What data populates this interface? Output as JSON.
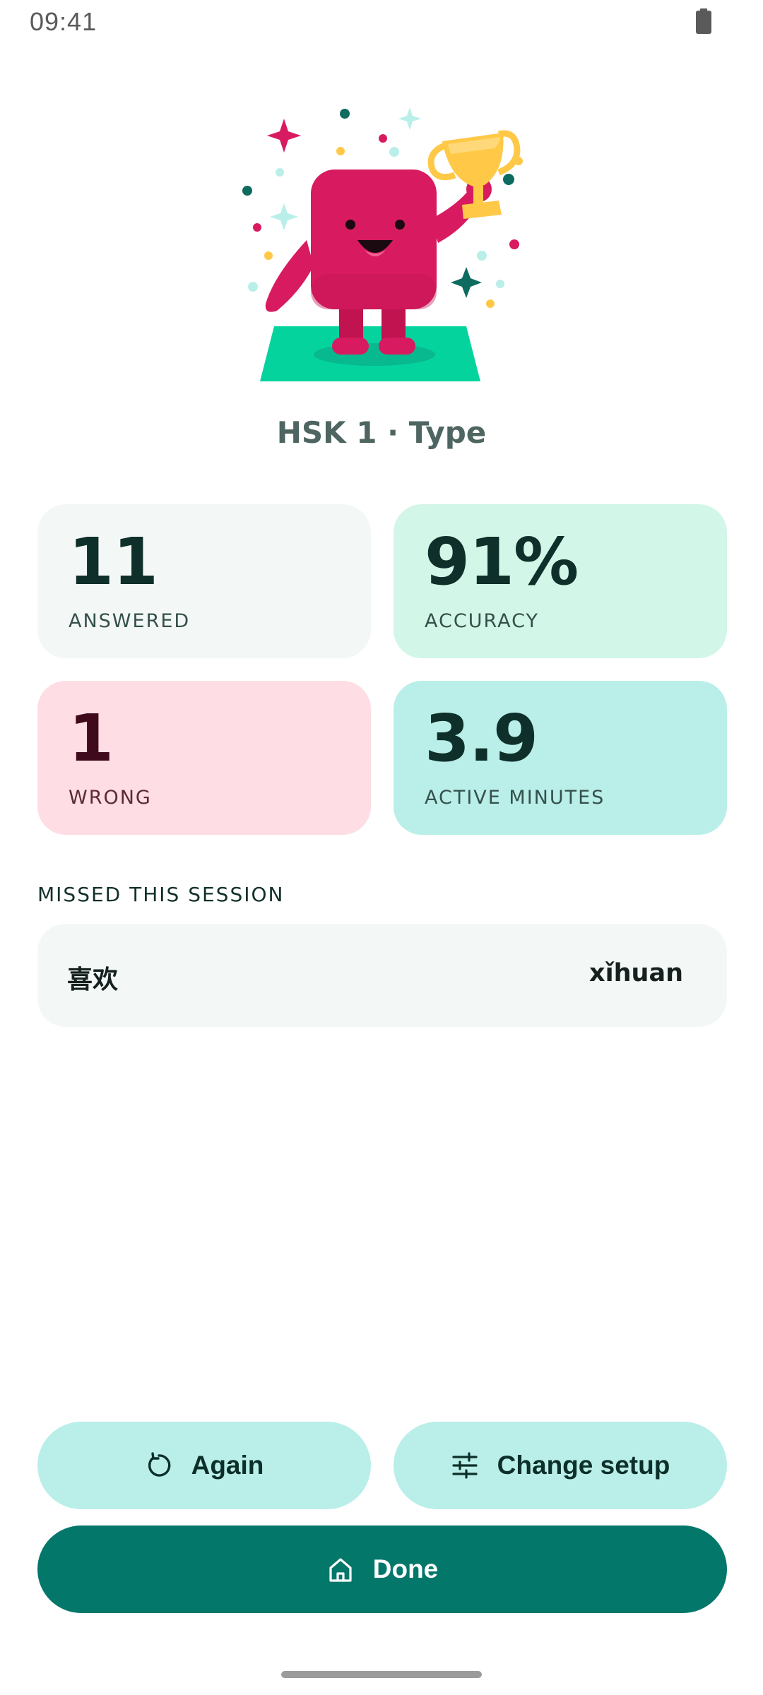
{
  "status_bar": {
    "time": "09:41",
    "battery_icon": "battery-icon"
  },
  "illustration": {
    "icon": "trophy-mascot-illustration",
    "colors": {
      "mascot": "#d81b60",
      "trophy": "#ffc847",
      "platform": "#05d39e",
      "sparkle_pink": "#d81b60",
      "sparkle_teal": "#0e6b60",
      "sparkle_light": "#b9efe8"
    }
  },
  "session_title": "HSK 1 · Type",
  "stats": {
    "answered": {
      "value": "11",
      "label": "ANSWERED",
      "color": "#f3f8f6"
    },
    "accuracy": {
      "value": "91%",
      "label": "ACCURACY",
      "color": "#d2f6e7"
    },
    "wrong": {
      "value": "1",
      "label": "WRONG",
      "color": "#fedde4"
    },
    "active_minutes": {
      "value": "3.9",
      "label": "ACTIVE MINUTES",
      "color": "#b9efe8"
    }
  },
  "missed": {
    "heading": "MISSED THIS SESSION",
    "items": [
      {
        "hanzi": "喜欢",
        "pinyin": "xǐhuan"
      }
    ]
  },
  "actions": {
    "again": {
      "label": "Again",
      "icon": "refresh-icon"
    },
    "change_setup": {
      "label": "Change setup",
      "icon": "sliders-icon"
    },
    "done": {
      "label": "Done",
      "icon": "home-icon"
    }
  },
  "colors": {
    "primary": "#04776b",
    "secondary_button": "#b9efe8",
    "text_dark": "#12302a"
  }
}
